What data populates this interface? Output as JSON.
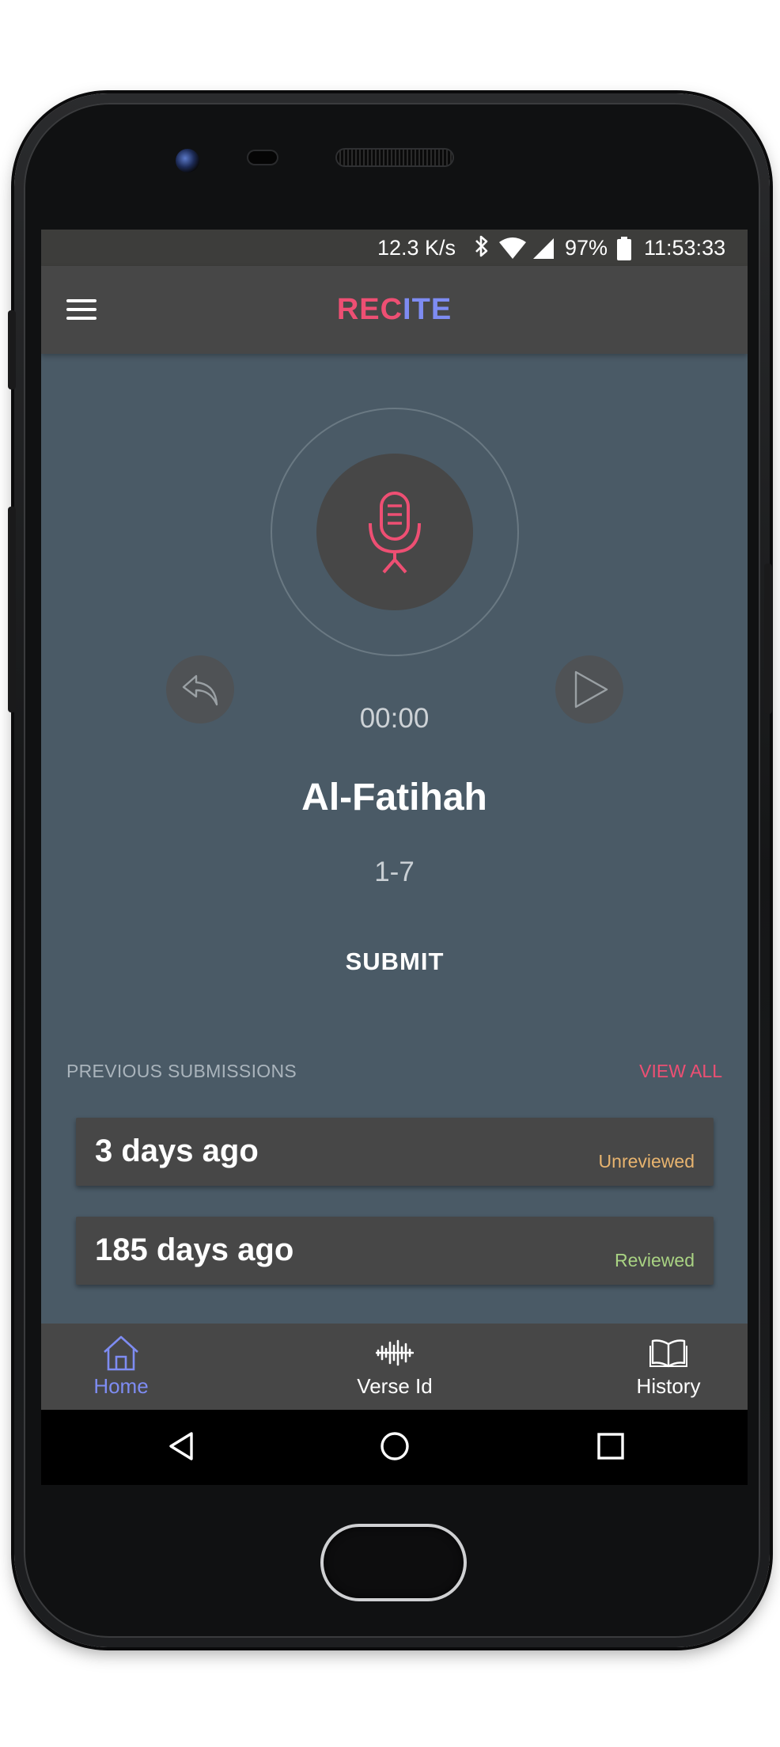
{
  "status_bar": {
    "speed": "12.3 K/s",
    "battery": "97%",
    "time": "11:53:33"
  },
  "app_bar": {
    "logo_part1": "REC",
    "logo_part2": "ITE"
  },
  "recorder": {
    "timer": "00:00",
    "surah": "Al-Fatihah",
    "verses": "1-7",
    "submit_label": "SUBMIT"
  },
  "submissions": {
    "title": "PREVIOUS SUBMISSIONS",
    "view_all": "VIEW ALL",
    "items": [
      {
        "when": "3 days ago",
        "status": "Unreviewed",
        "status_color": "#e8b46f"
      },
      {
        "when": "185 days ago",
        "status": "Reviewed",
        "status_color": "#a9d383"
      }
    ]
  },
  "bottom_nav": {
    "items": [
      {
        "label": "Home",
        "icon": "home-icon",
        "active": true
      },
      {
        "label": "Verse Id",
        "icon": "soundwave-icon",
        "active": false
      },
      {
        "label": "History",
        "icon": "book-icon",
        "active": false
      }
    ]
  },
  "colors": {
    "accent_pink": "#ee4f73",
    "accent_blue": "#7e8cf2",
    "background": "#4a5a66",
    "surface": "#474747"
  }
}
